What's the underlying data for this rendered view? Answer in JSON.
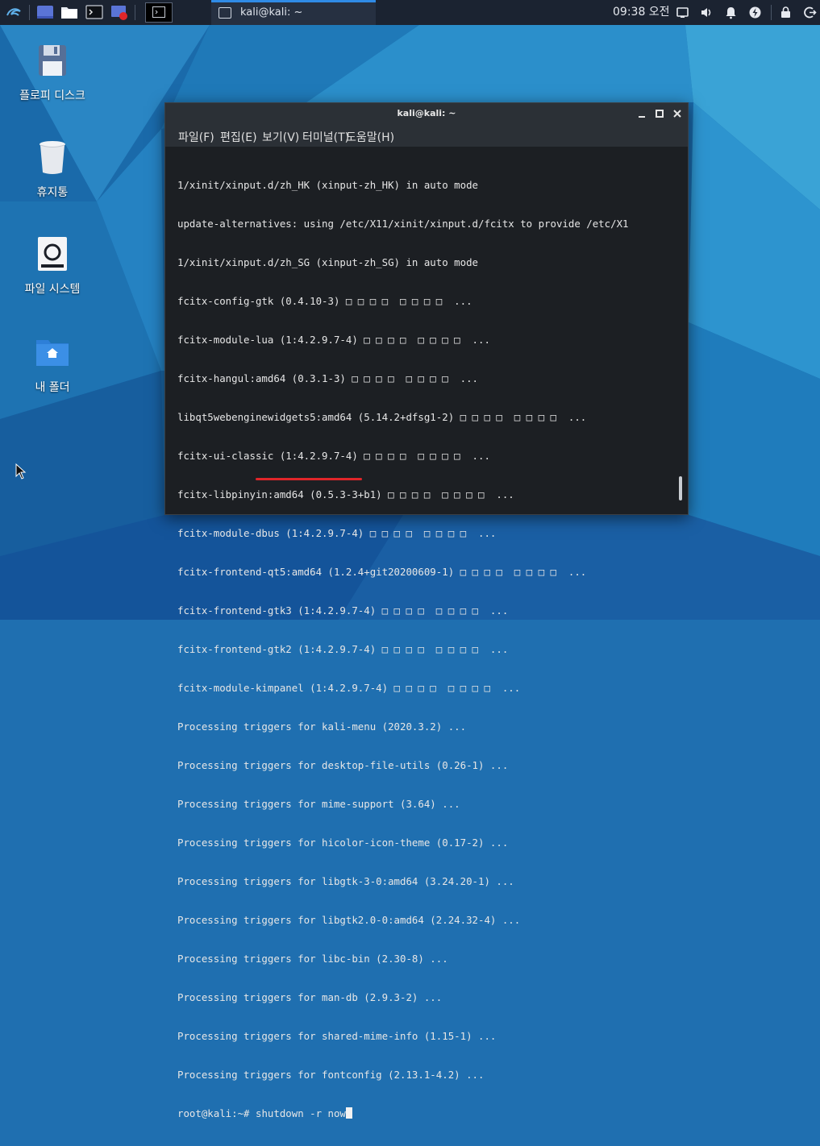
{
  "panel": {
    "task_title": "kali@kali: ~",
    "clock": "09:38 오전"
  },
  "desktop": {
    "icons": [
      {
        "label": "플로피 디스크"
      },
      {
        "label": "휴지통"
      },
      {
        "label": "파일 시스템"
      },
      {
        "label": "내 폴더"
      }
    ]
  },
  "terminal": {
    "title": "kali@kali: ~",
    "menu": [
      "파일(F)",
      "편집(E)",
      "보기(V)",
      "터미널(T)",
      "도움말(H)"
    ],
    "lines": [
      "1/xinit/xinput.d/zh_HK (xinput-zh_HK) in auto mode",
      "update-alternatives: using /etc/X11/xinit/xinput.d/fcitx to provide /etc/X1",
      "1/xinit/xinput.d/zh_SG (xinput-zh_SG) in auto mode",
      "fcitx-config-gtk (0.4.10-3) □ □ □ □  □ □ □ □  ...",
      "fcitx-module-lua (1:4.2.9.7-4) □ □ □ □  □ □ □ □  ...",
      "fcitx-hangul:amd64 (0.3.1-3) □ □ □ □  □ □ □ □  ...",
      "libqt5webenginewidgets5:amd64 (5.14.2+dfsg1-2) □ □ □ □  □ □ □ □  ...",
      "fcitx-ui-classic (1:4.2.9.7-4) □ □ □ □  □ □ □ □  ...",
      "fcitx-libpinyin:amd64 (0.5.3-3+b1) □ □ □ □  □ □ □ □  ...",
      "fcitx-module-dbus (1:4.2.9.7-4) □ □ □ □  □ □ □ □  ...",
      "fcitx-frontend-qt5:amd64 (1.2.4+git20200609-1) □ □ □ □  □ □ □ □  ...",
      "fcitx-frontend-gtk3 (1:4.2.9.7-4) □ □ □ □  □ □ □ □  ...",
      "fcitx-frontend-gtk2 (1:4.2.9.7-4) □ □ □ □  □ □ □ □  ...",
      "fcitx-module-kimpanel (1:4.2.9.7-4) □ □ □ □  □ □ □ □  ...",
      "Processing triggers for kali-menu (2020.3.2) ...",
      "Processing triggers for desktop-file-utils (0.26-1) ...",
      "Processing triggers for mime-support (3.64) ...",
      "Processing triggers for hicolor-icon-theme (0.17-2) ...",
      "Processing triggers for libgtk-3-0:amd64 (3.24.20-1) ...",
      "Processing triggers for libgtk2.0-0:amd64 (2.24.32-4) ...",
      "Processing triggers for libc-bin (2.30-8) ...",
      "Processing triggers for man-db (2.9.3-2) ...",
      "Processing triggers for shared-mime-info (1.15-1) ...",
      "Processing triggers for fontconfig (2.13.1-4.2) ..."
    ],
    "prompt": "root@kali:~# ",
    "command": "shutdown -r now"
  }
}
